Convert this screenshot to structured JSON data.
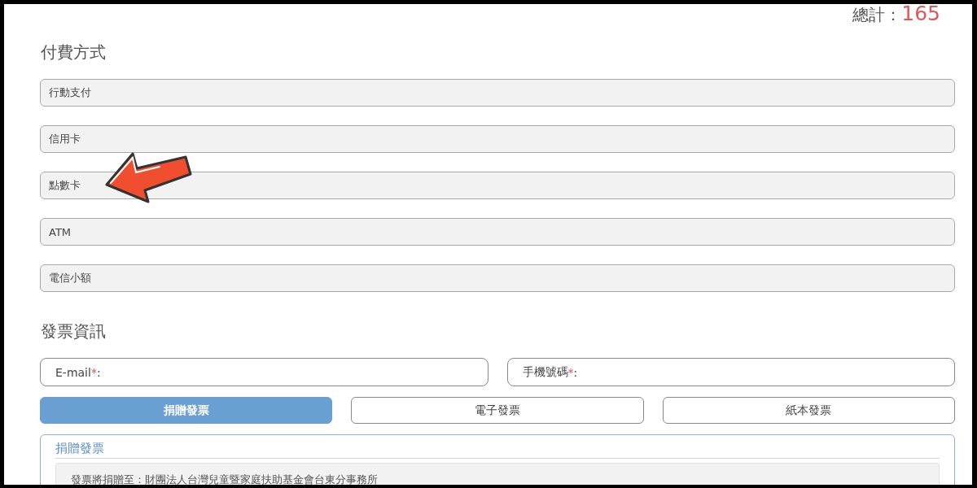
{
  "total": {
    "label": "總計：",
    "amount": "165"
  },
  "payment": {
    "title": "付費方式",
    "options": [
      {
        "label": "行動支付"
      },
      {
        "label": "信用卡"
      },
      {
        "label": "點數卡"
      },
      {
        "label": "ATM"
      },
      {
        "label": "電信小額"
      }
    ]
  },
  "invoice": {
    "title": "發票資訊",
    "fields": [
      {
        "label": "E-mail",
        "required_mark": "*",
        "suffix": ":"
      },
      {
        "label": "手機號碼",
        "required_mark": "*",
        "suffix": ":"
      }
    ],
    "types": [
      {
        "label": "捐贈發票",
        "selected": true
      },
      {
        "label": "電子發票",
        "selected": false
      },
      {
        "label": "紙本發票",
        "selected": false
      }
    ],
    "donation": {
      "title": "捐贈發票",
      "note": "發票將捐贈至：財團法人台灣兒童暨家庭扶助基金會台東分事務所"
    }
  }
}
